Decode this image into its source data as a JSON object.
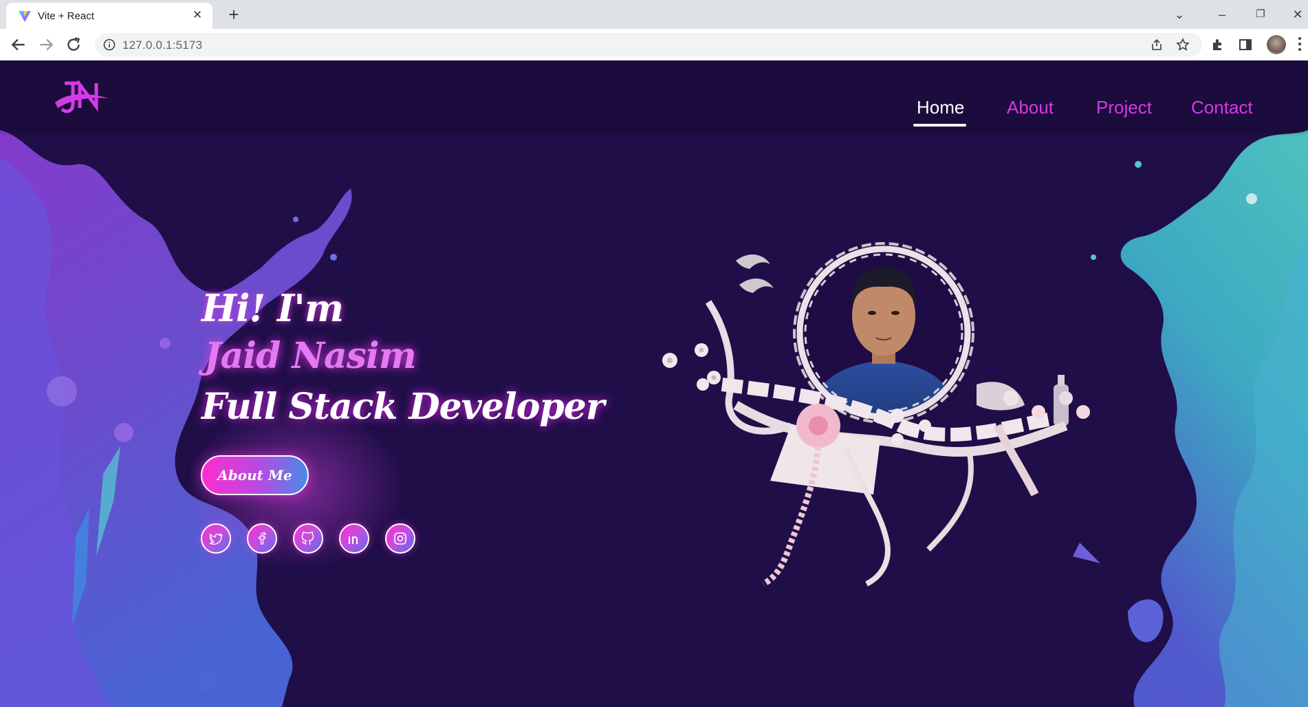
{
  "browser": {
    "tab_title": "Vite + React",
    "url": "127.0.0.1:5173"
  },
  "site": {
    "nav": [
      "Home",
      "About",
      "Project",
      "Contact"
    ],
    "active_nav": "Home",
    "hero": {
      "greeting": "Hi! I'm",
      "name": "Jaid Nasim",
      "role": "Full Stack Developer",
      "cta_label": "About Me"
    },
    "social_icons": [
      "twitter-icon",
      "facebook-icon",
      "github-icon",
      "linkedin-icon",
      "instagram-icon"
    ],
    "colors": {
      "background": "#200e48",
      "header": "#1c0b3d",
      "accent": "#d63ae6",
      "name_glow": "#e27bf2"
    }
  }
}
